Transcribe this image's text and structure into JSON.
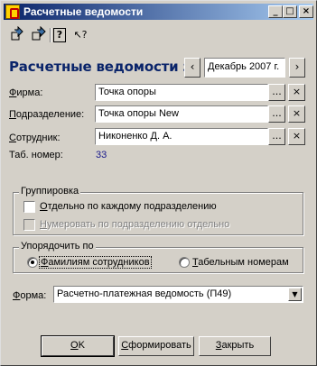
{
  "window": {
    "title": "Расчетные ведомости",
    "controls": {
      "minimize": "_",
      "maximize": "□",
      "close": "×"
    }
  },
  "toolbar": {
    "icons": [
      "restore-icon",
      "save-icon",
      "help-icon",
      "context-help-icon"
    ],
    "glyphs": {
      "help": "?",
      "context_help": "↖?"
    }
  },
  "header": {
    "title": "Расчетные ведомости за",
    "period": "Декабрь 2007 г.",
    "prev": "‹",
    "next": "›"
  },
  "fields": {
    "firm": {
      "label_u": "Ф",
      "label_rest": "ирма:",
      "value": "Точка опоры"
    },
    "department": {
      "label_u": "П",
      "label_rest": "одразделение:",
      "value": "Точка опоры New"
    },
    "employee": {
      "label_u": "С",
      "label_rest": "отрудник:",
      "value": "Никоненко Д. А."
    },
    "tab_number": {
      "label": "Таб. номер:",
      "value": "33"
    },
    "select_glyph": "...",
    "clear_glyph": "×"
  },
  "grouping": {
    "caption": "Группировка",
    "by_department": {
      "label_u": "О",
      "label_rest": "тдельно по каждому подразделению",
      "checked": false
    },
    "number_by_department": {
      "label_u": "Н",
      "label_rest": "умеровать по подразделению отдельно",
      "checked": false,
      "disabled": true
    }
  },
  "ordering": {
    "caption": "Упорядочить по",
    "by_name": {
      "label_u": "Ф",
      "label_rest": "амилиям сотрудников",
      "selected": true
    },
    "by_number": {
      "label_u": "Т",
      "label_rest": "абельным номерам",
      "selected": false
    }
  },
  "form": {
    "label_u": "Ф",
    "label_rest": "орма:",
    "value": "Расчетно-платежная ведомость (П49)",
    "dropdown": "▼"
  },
  "buttons": {
    "ok": {
      "label_u": "О",
      "label_rest": "K"
    },
    "generate": {
      "label_u": "С",
      "label_rest": "формировать"
    },
    "close": {
      "label_u": "З",
      "label_rest": "акрыть"
    }
  }
}
